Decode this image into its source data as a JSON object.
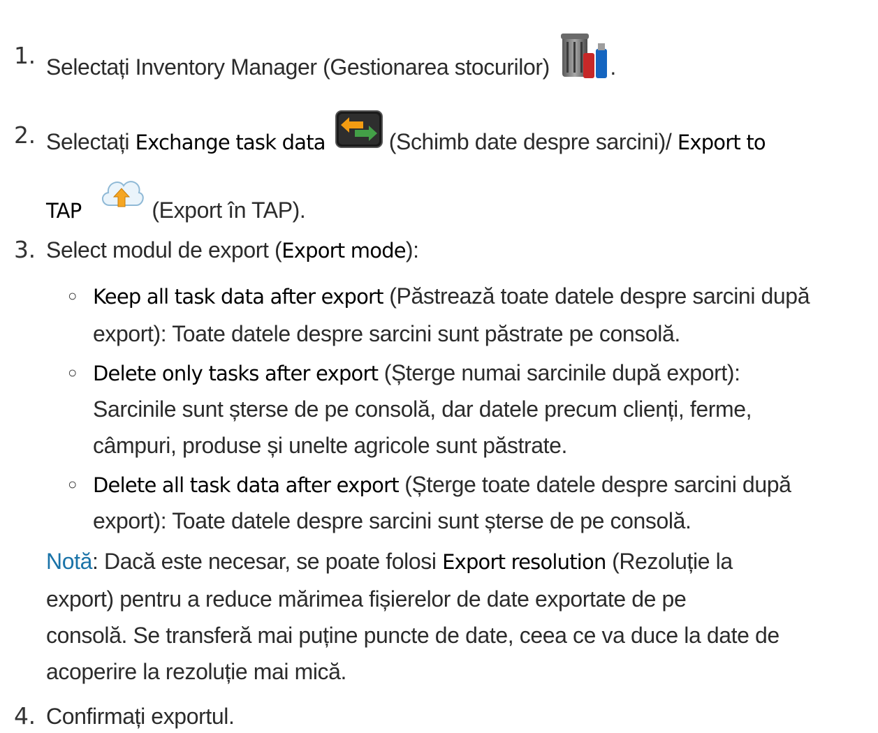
{
  "steps": [
    {
      "number": "1.",
      "pre": "Selectați Inventory Manager (Gestionarea stocurilor)",
      "icon": "inventory-manager-icon",
      "post": "."
    },
    {
      "number": "2.",
      "pre": "Selectați ",
      "b1": "Exchange task data",
      "icon1": "exchange-task-data-icon",
      "mid": " (Schimb date despre sarcini)/ ",
      "b2": "Export to",
      "b2b": "TAP",
      "icon2": "cloud-upload-icon",
      "post": " (Export în TAP)."
    },
    {
      "number": "3.",
      "pre": "Select modul de export (",
      "b1": "Export mode",
      "post": "):"
    },
    {
      "number": "4.",
      "text": "Confirmați exportul."
    }
  ],
  "options": [
    {
      "bold": "Keep all task data after export",
      "line1": " (Păstrează toate datele despre sarcini după",
      "line2": "export): Toate datele despre sarcini sunt păstrate pe consolă."
    },
    {
      "bold": "Delete only tasks after export",
      "line1": " (Șterge numai sarcinile după export):",
      "line2": "Sarcinile sunt șterse de pe consolă, dar datele precum clienți, ferme,",
      "line3": "câmpuri, produse și unelte agricole sunt păstrate."
    },
    {
      "bold": "Delete all task data after export",
      "line1": " (Șterge toate datele despre sarcini după",
      "line2": "export): Toate datele despre sarcini sunt șterse de pe consolă."
    }
  ],
  "bullet_glyph": "○",
  "note": {
    "label": "Notă",
    "line1a": ": Dacă este necesar, se poate folosi ",
    "bold": "Export resolution",
    "line1b": " (Rezoluție la",
    "line2": "export) pentru a reduce mărimea fișierelor de date exportate de pe",
    "line3": "consolă. Se transferă mai puține puncte de date, ceea ce va duce la date de",
    "line4": "acoperire la rezoluție mai mică."
  },
  "colors": {
    "note_label": "#1a73a8",
    "text": "#2b2b2b"
  }
}
